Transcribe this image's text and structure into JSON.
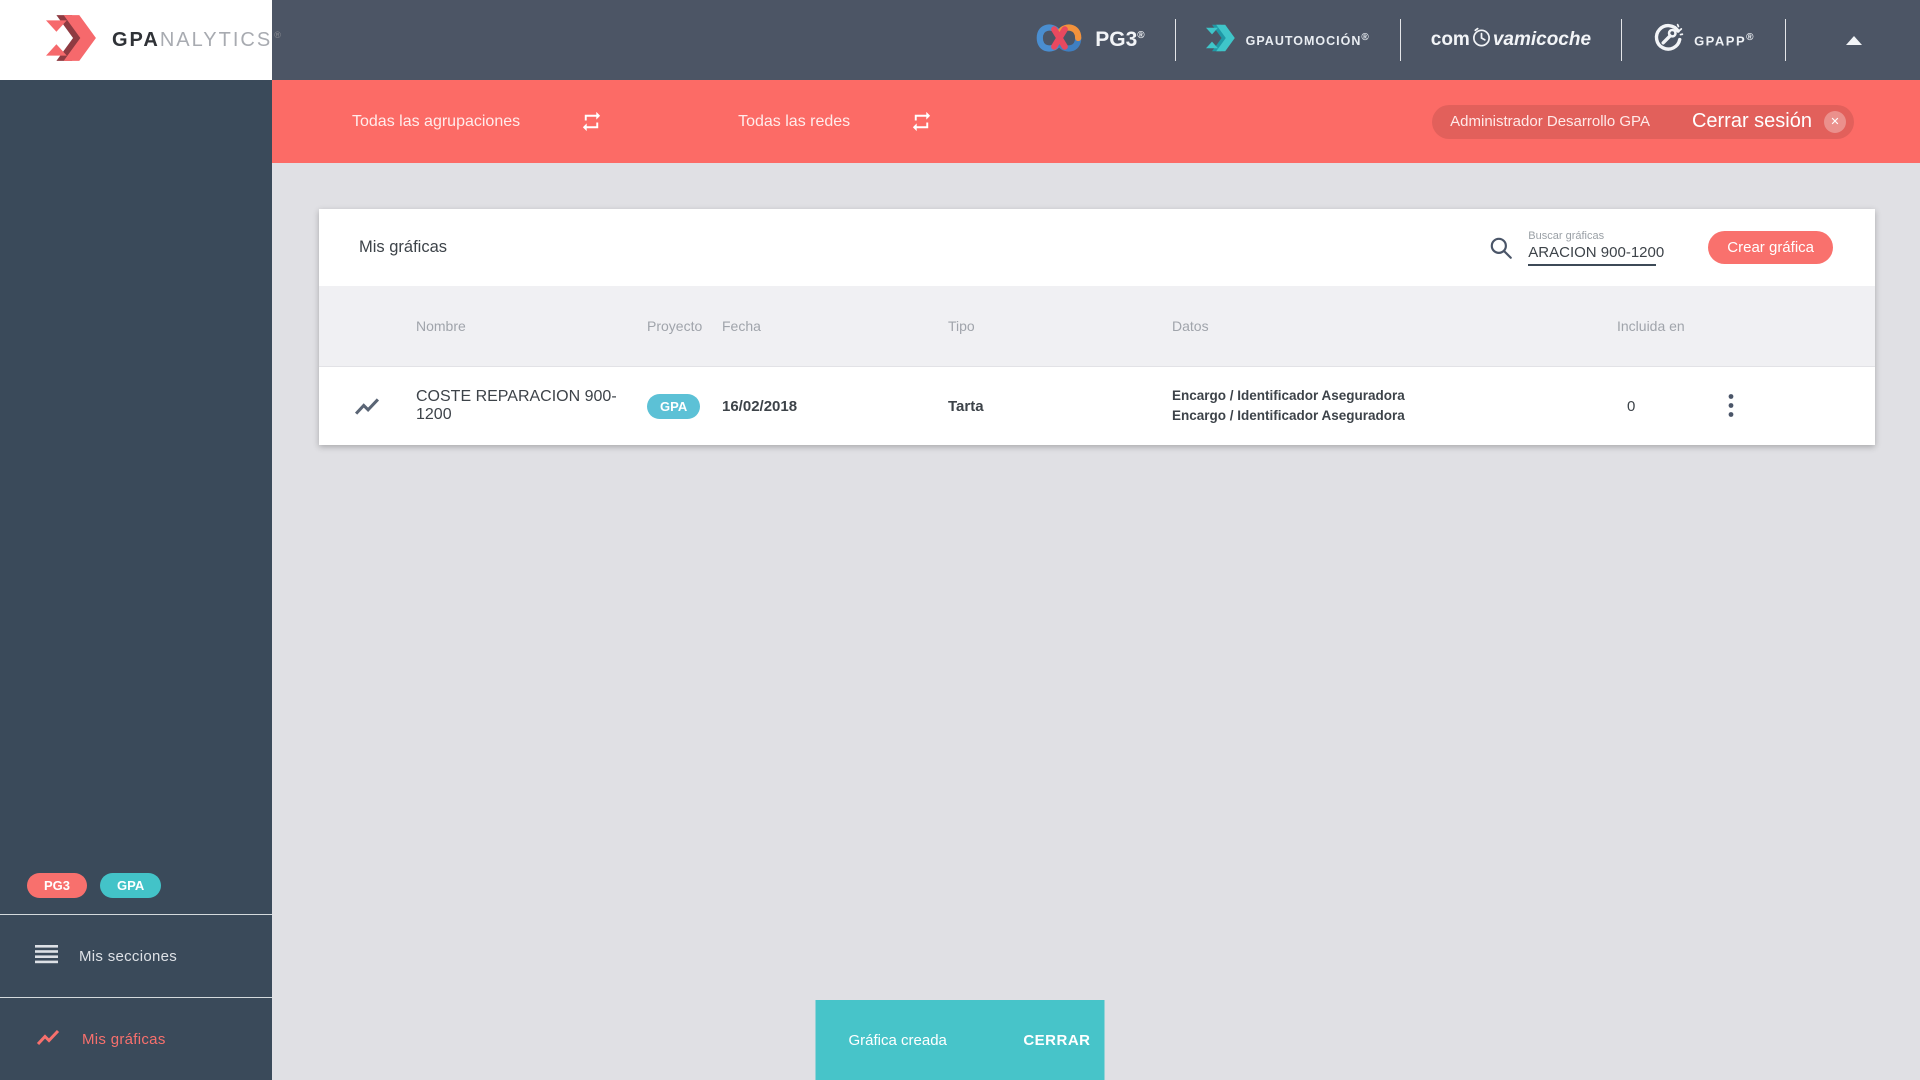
{
  "app": {
    "brand_bold": "GPA",
    "brand_light": "NALYTICS",
    "registered": "®"
  },
  "topbar": {
    "pg3_label": "PG3",
    "gpautomocion_label": "GPAUTOMOCIÓN",
    "comprova_pre": "com",
    "comprova_post": "vamicoche",
    "gpapp_label": "GPAPP",
    "registered": "®"
  },
  "filterbar": {
    "agrupaciones_label": "Todas las agrupaciones",
    "redes_label": "Todas las redes",
    "user_name": "Administrador Desarrollo GPA",
    "logout_label": "Cerrar sesión",
    "close_x": "✕"
  },
  "sidebar": {
    "badge_pg3": "PG3",
    "badge_gpa": "GPA",
    "mis_secciones": "Mis secciones",
    "mis_graficas": "Mis gráficas"
  },
  "card": {
    "title": "Mis gráficas",
    "search_label": "Buscar gráficas",
    "search_value": "ARACION 900-1200",
    "create_button": "Crear gráfica",
    "table": {
      "headers": {
        "nombre": "Nombre",
        "proyecto": "Proyecto",
        "fecha": "Fecha",
        "tipo": "Tipo",
        "datos": "Datos",
        "incluida": "Incluida en"
      },
      "rows": [
        {
          "nombre": "COSTE REPARACION 900-1200",
          "proyecto_badge": "GPA",
          "fecha": "16/02/2018",
          "tipo": "Tarta",
          "datos_1": "Encargo / Identificador Aseguradora",
          "datos_2": "Encargo / Identificador Aseguradora",
          "incluida": "0"
        }
      ]
    }
  },
  "snackbar": {
    "message": "Gráfica creada",
    "action": "CERRAR"
  },
  "colors": {
    "accent_red": "#fc6b66",
    "accent_teal": "#47c4c9",
    "table_badge_blue": "#5cc1d6",
    "topbar_bg": "#4c5565",
    "sidebar_bg": "#3a4a5a",
    "page_bg": "#e0e0e4"
  }
}
